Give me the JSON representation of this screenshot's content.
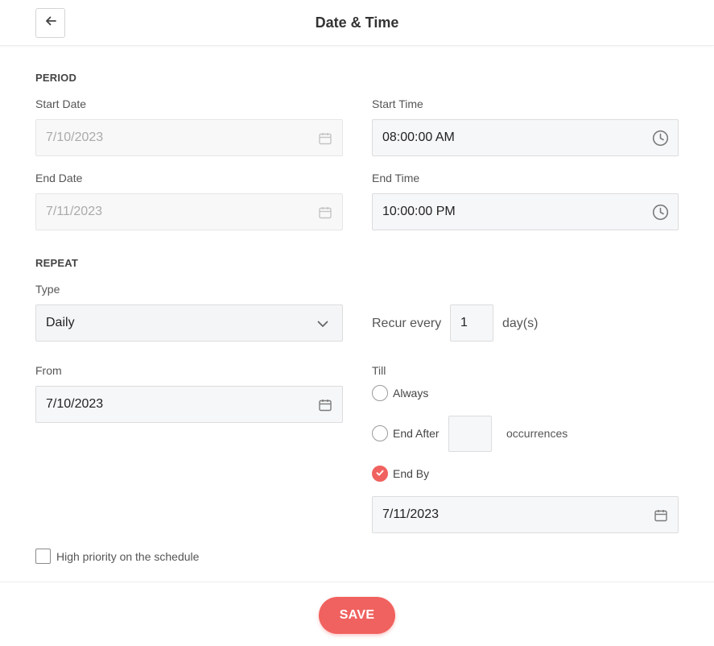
{
  "header": {
    "title": "Date & Time"
  },
  "period": {
    "section_title": "PERIOD",
    "start_date": {
      "label": "Start Date",
      "value": "7/10/2023"
    },
    "start_time": {
      "label": "Start Time",
      "value": "08:00:00 AM"
    },
    "end_date": {
      "label": "End Date",
      "value": "7/11/2023"
    },
    "end_time": {
      "label": "End Time",
      "value": "10:00:00 PM"
    }
  },
  "repeat": {
    "section_title": "REPEAT",
    "type": {
      "label": "Type",
      "selected": "Daily"
    },
    "recur": {
      "prefix": "Recur every",
      "value": "1",
      "suffix": "day(s)"
    },
    "from": {
      "label": "From",
      "value": "7/10/2023"
    },
    "till": {
      "label": "Till",
      "options": {
        "always": "Always",
        "end_after": "End After",
        "occurrences_value": "",
        "occurrences_suffix": "occurrences",
        "end_by": "End By"
      },
      "selected": "end_by",
      "end_by_date": "7/11/2023"
    }
  },
  "high_priority": {
    "label": "High priority on the schedule",
    "checked": false
  },
  "footer": {
    "save_label": "SAVE"
  },
  "colors": {
    "accent": "#f0625f",
    "field_bg": "#f6f7f9",
    "border": "#dcdcdc"
  }
}
